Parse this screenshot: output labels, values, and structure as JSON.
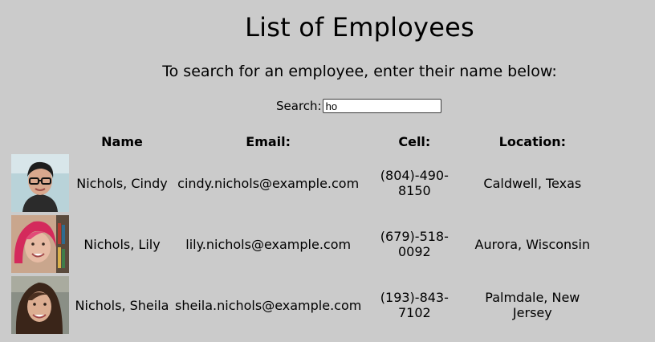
{
  "page": {
    "title": "List of Employees",
    "subtitle": "To search for an employee, enter their name below:"
  },
  "search": {
    "label": "Search:",
    "value": "ho"
  },
  "table": {
    "headers": {
      "image": "",
      "name": "Name",
      "email": "Email:",
      "cell": "Cell:",
      "location": "Location:"
    },
    "rows": [
      {
        "name": "Nichols, Cindy",
        "email": "cindy.nichols@example.com",
        "cell": "(804)-490-8150",
        "location": "Caldwell, Texas",
        "photo": "employee-photo-cindy"
      },
      {
        "name": "Nichols, Lily",
        "email": "lily.nichols@example.com",
        "cell": "(679)-518-0092",
        "location": "Aurora, Wisconsin",
        "photo": "employee-photo-lily"
      },
      {
        "name": "Nichols, Sheila",
        "email": "sheila.nichols@example.com",
        "cell": "(193)-843-7102",
        "location": "Palmdale, New Jersey",
        "photo": "employee-photo-sheila"
      }
    ]
  },
  "colors": {
    "background": "#cbcbcb",
    "input_background": "#ffffff"
  }
}
